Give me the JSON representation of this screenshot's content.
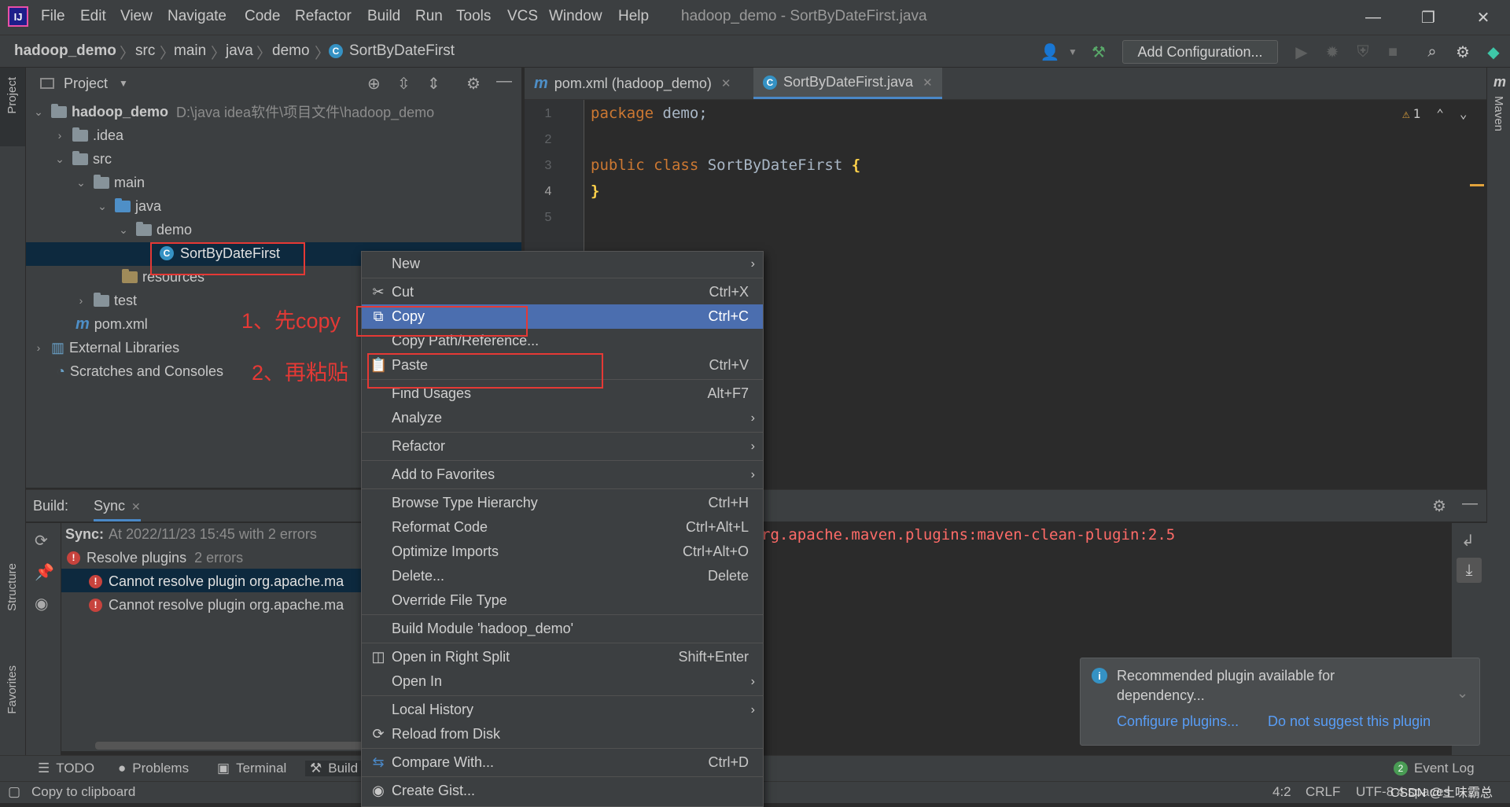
{
  "app": {
    "window_title": "hadoop_demo - SortByDateFirst.java",
    "menu": [
      "File",
      "Edit",
      "View",
      "Navigate",
      "Code",
      "Refactor",
      "Build",
      "Run",
      "Tools",
      "VCS",
      "Window",
      "Help"
    ]
  },
  "breadcrumb": [
    "hadoop_demo",
    "src",
    "main",
    "java",
    "demo",
    "SortByDateFirst"
  ],
  "toolbar": {
    "add_config": "Add Configuration..."
  },
  "project": {
    "title": "Project",
    "root": "hadoop_demo",
    "root_path": "D:\\java idea软件\\项目文件\\hadoop_demo",
    "items": {
      "idea": ".idea",
      "src": "src",
      "main": "main",
      "java": "java",
      "demo": "demo",
      "file": "SortByDateFirst",
      "resources": "resources",
      "test": "test",
      "pom": "pom.xml",
      "ext": "External Libraries",
      "scratches": "Scratches and Consoles"
    }
  },
  "editor": {
    "tabs": [
      "pom.xml (hadoop_demo)",
      "SortByDateFirst.java"
    ],
    "lines": [
      "1",
      "2",
      "3",
      "4",
      "5"
    ],
    "code": {
      "l1_kw": "package",
      "l1_rest": " demo;",
      "l3_kw1": "public",
      "l3_kw2": " class",
      "l3_name": " SortByDateFirst ",
      "l3_brace": "{",
      "l4_brace": "}"
    },
    "warnings": "1"
  },
  "build": {
    "label": "Build:",
    "tab": "Sync",
    "sync_label": "Sync:",
    "sync_text": "At 2022/11/23 15:45 with 2 errors",
    "resolve": "Resolve plugins",
    "resolve_count": "2 errors",
    "err1": "Cannot resolve plugin org.apache.ma",
    "err2": "Cannot resolve plugin org.apache.ma",
    "console": "rg.apache.maven.plugins:maven-clean-plugin:2.5"
  },
  "context_menu": {
    "new": "New",
    "cut": "Cut",
    "cut_sc": "Ctrl+X",
    "copy": "Copy",
    "copy_sc": "Ctrl+C",
    "copy_path": "Copy Path/Reference...",
    "paste": "Paste",
    "paste_sc": "Ctrl+V",
    "find_usages": "Find Usages",
    "find_sc": "Alt+F7",
    "analyze": "Analyze",
    "refactor": "Refactor",
    "add_fav": "Add to Favorites",
    "browse": "Browse Type Hierarchy",
    "browse_sc": "Ctrl+H",
    "reformat": "Reformat Code",
    "reformat_sc": "Ctrl+Alt+L",
    "optimize": "Optimize Imports",
    "optimize_sc": "Ctrl+Alt+O",
    "delete": "Delete...",
    "delete_sc": "Delete",
    "override": "Override File Type",
    "build_module": "Build Module 'hadoop_demo'",
    "open_right": "Open in Right Split",
    "open_right_sc": "Shift+Enter",
    "open_in": "Open In",
    "local_history": "Local History",
    "reload": "Reload from Disk",
    "compare": "Compare With...",
    "compare_sc": "Ctrl+D",
    "create_gist": "Create Gist..."
  },
  "annotations": {
    "step1": "1、先copy",
    "step2": "2、再粘贴"
  },
  "notification": {
    "text": "Recommended plugin available for dependency...",
    "configure": "Configure plugins...",
    "dismiss": "Do not suggest this plugin"
  },
  "tool_tabs": [
    "TODO",
    "Problems",
    "Terminal",
    "Build"
  ],
  "event_log": "Event Log",
  "event_count": "2",
  "status": {
    "message": "Copy to clipboard",
    "pos": "4:2",
    "eol": "CRLF",
    "enc": "UTF-8",
    "indent": "4 spaces"
  },
  "watermark": "CSDN @土味霸总",
  "side_tabs": {
    "project": "Project",
    "structure": "Structure",
    "favorites": "Favorites",
    "maven": "Maven"
  }
}
